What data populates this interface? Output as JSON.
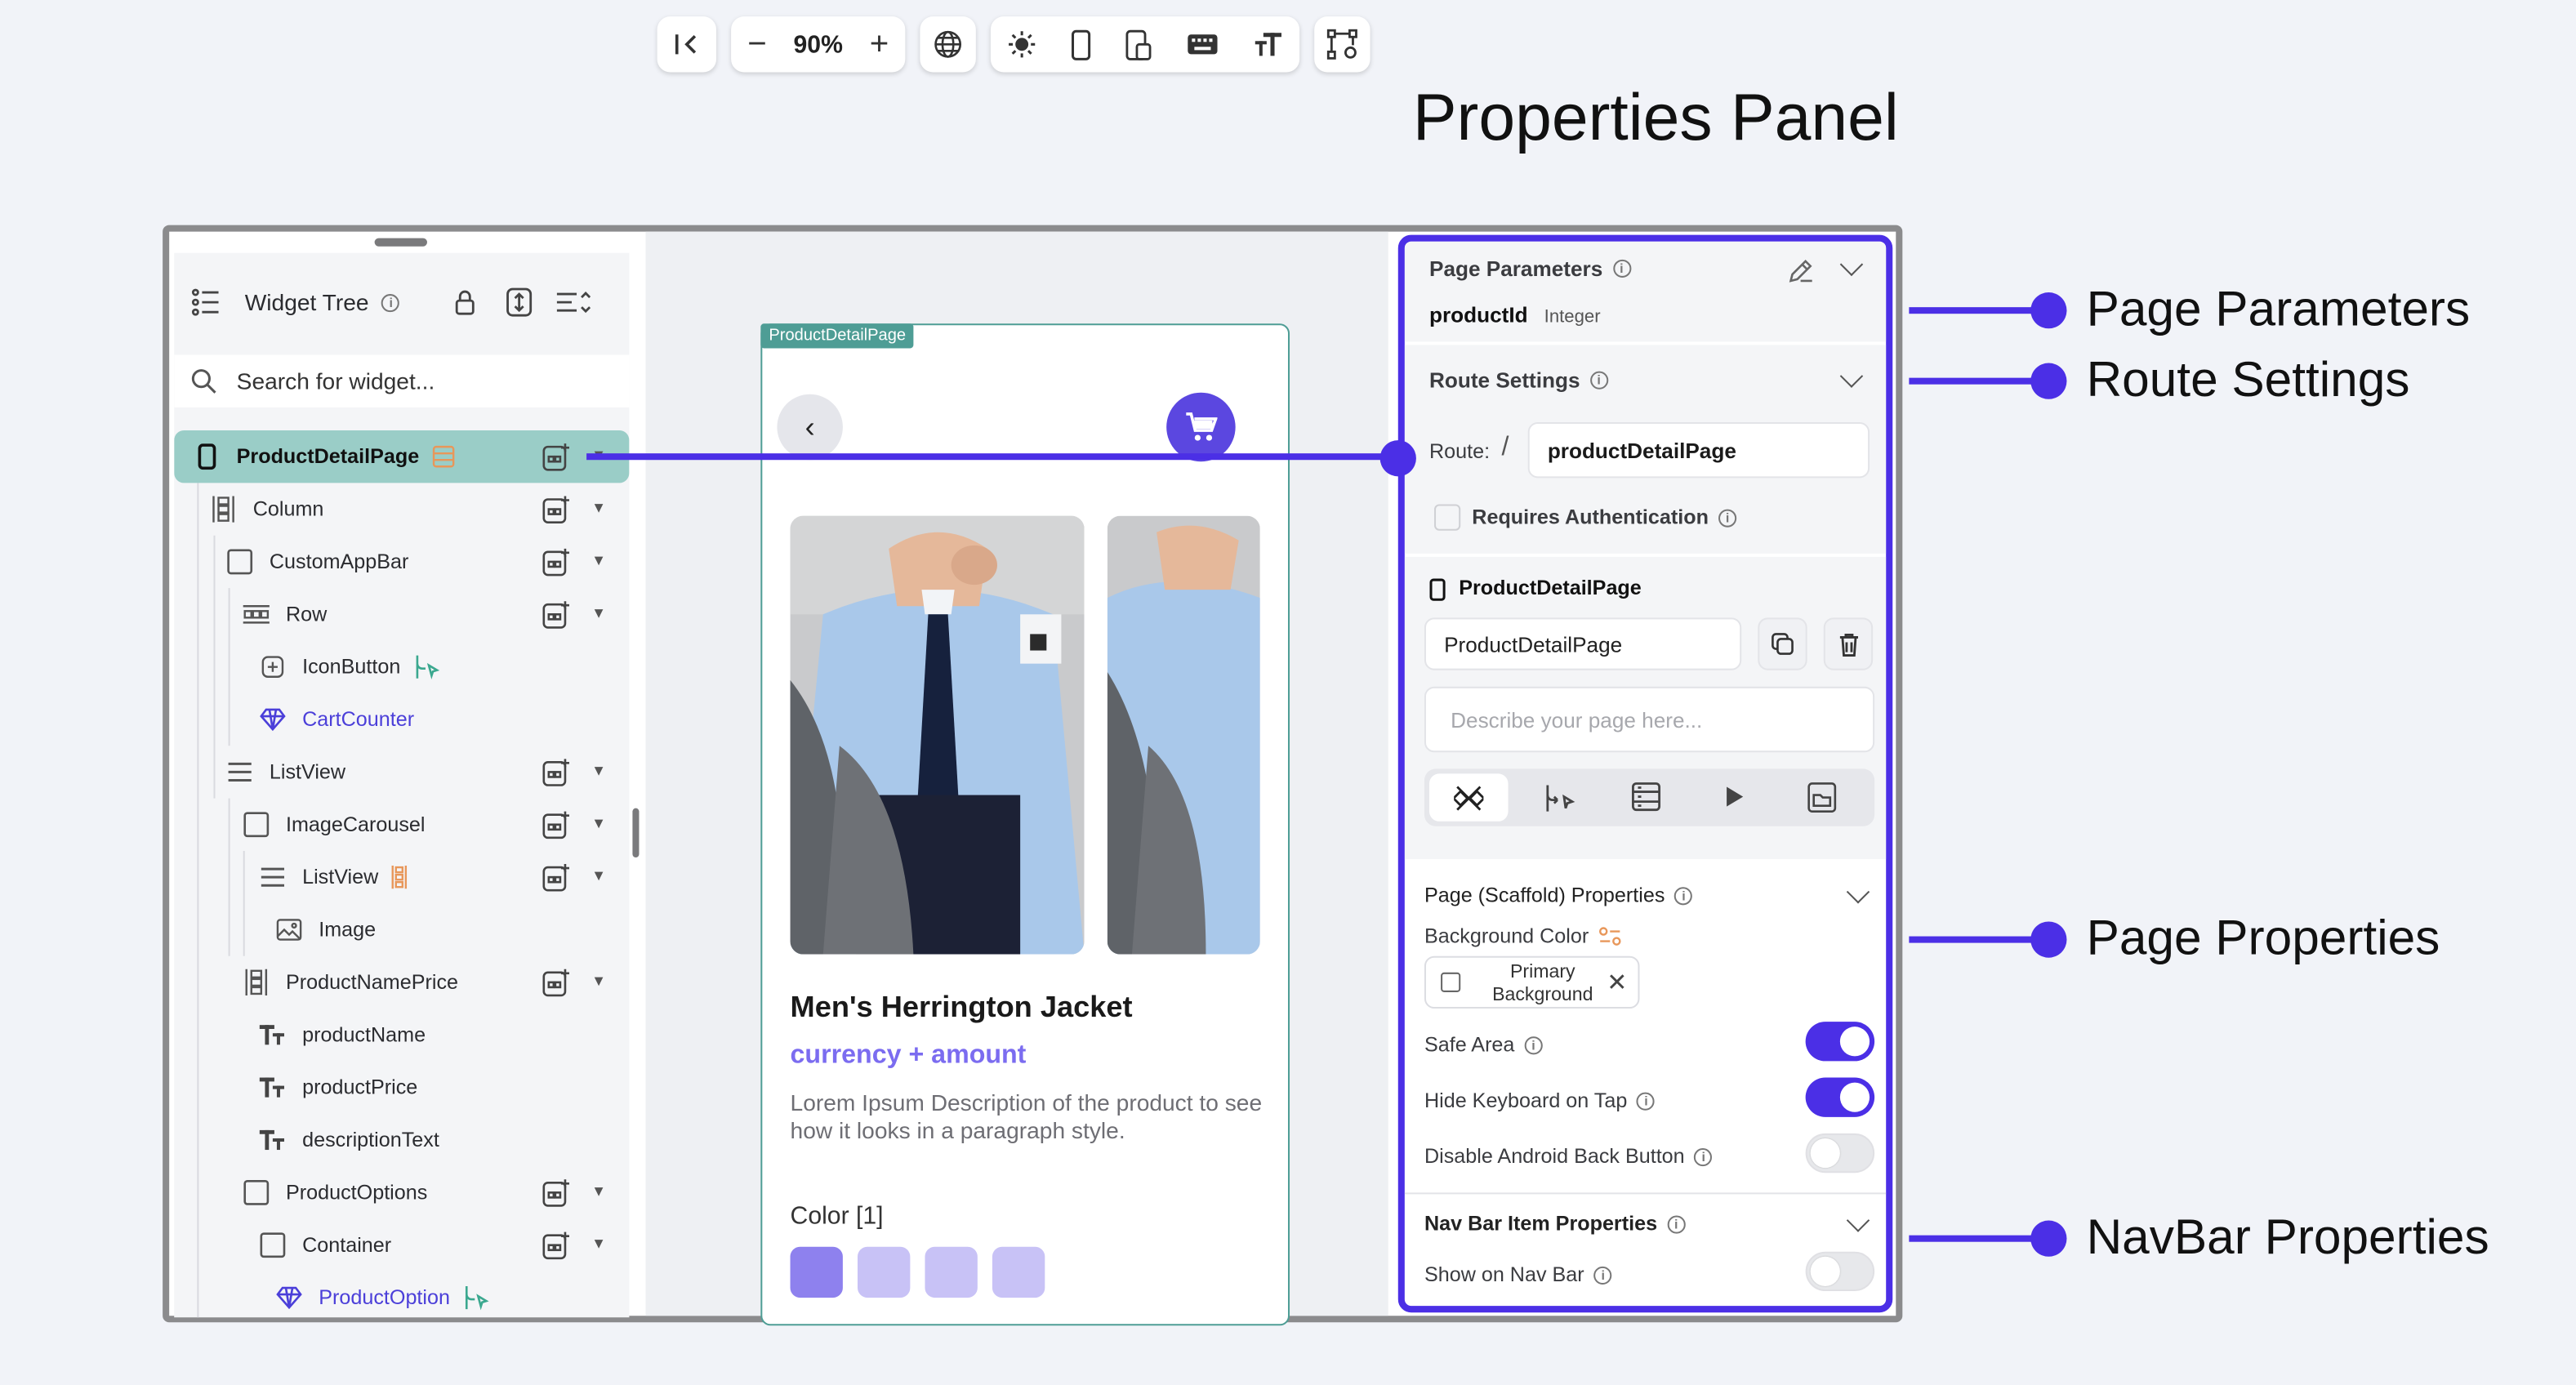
{
  "title": "Properties Panel",
  "widget_tree": {
    "title": "Widget Tree",
    "search_placeholder": "Search for widget...",
    "items": [
      {
        "label": "ProductDetailPage",
        "icon": "phone-icon"
      },
      {
        "label": "Column",
        "icon": "column-icon"
      },
      {
        "label": "CustomAppBar",
        "icon": "container-icon"
      },
      {
        "label": "Row",
        "icon": "row-icon"
      },
      {
        "label": "IconButton",
        "icon": "icon-button-icon"
      },
      {
        "label": "CartCounter",
        "icon": "component-icon"
      },
      {
        "label": "ListView",
        "icon": "listview-icon"
      },
      {
        "label": "ImageCarousel",
        "icon": "container-icon"
      },
      {
        "label": "ListView",
        "icon": "listview-icon"
      },
      {
        "label": "Image",
        "icon": "image-icon"
      },
      {
        "label": "ProductNamePrice",
        "icon": "column-icon"
      },
      {
        "label": "productName",
        "icon": "text-icon"
      },
      {
        "label": "productPrice",
        "icon": "text-icon"
      },
      {
        "label": "descriptionText",
        "icon": "text-icon"
      },
      {
        "label": "ProductOptions",
        "icon": "container-icon"
      },
      {
        "label": "Container",
        "icon": "container-icon"
      },
      {
        "label": "ProductOption",
        "icon": "component-icon"
      }
    ]
  },
  "toolbar": {
    "zoom": "90%"
  },
  "canvas": {
    "page_tag": "ProductDetailPage",
    "product_name": "Men's Herrington Jacket",
    "product_price": "currency + amount",
    "description": "Lorem Ipsum Description of the product to see how it looks in a paragraph style.",
    "color_label": "Color [1]",
    "swatch_colors": [
      "#8E81EE",
      "#C8C2F6",
      "#C8C2F6",
      "#C8C2F6"
    ]
  },
  "properties": {
    "page_parameters": {
      "header": "Page Parameters",
      "param_name": "productId",
      "param_type": "Integer"
    },
    "route_settings": {
      "header": "Route Settings",
      "route_label": "Route:",
      "route_slash": "/",
      "route_value": "productDetailPage",
      "requires_auth": "Requires Authentication"
    },
    "page": {
      "header": "ProductDetailPage",
      "name_value": "ProductDetailPage",
      "description_placeholder": "Describe your page here..."
    },
    "scaffold": {
      "header": "Page (Scaffold) Properties",
      "bg_label": "Background Color",
      "bg_value": "Primary Background",
      "safe_area": "Safe Area",
      "safe_area_on": true,
      "hide_keyboard": "Hide Keyboard on Tap",
      "hide_keyboard_on": true,
      "disable_back": "Disable Android Back Button",
      "disable_back_on": false
    },
    "navbar": {
      "header": "Nav Bar Item Properties",
      "show_on_nav": "Show on Nav Bar",
      "show_on_nav_on": false
    }
  },
  "callouts": {
    "page_parameters": "Page Parameters",
    "route_settings": "Route Settings",
    "page_properties": "Page Properties",
    "navbar_properties": "NavBar Properties"
  },
  "colors": {
    "accent": "#4B2FE6",
    "selected_row": "#9ACDC7",
    "page_outline": "#4E9D95"
  }
}
